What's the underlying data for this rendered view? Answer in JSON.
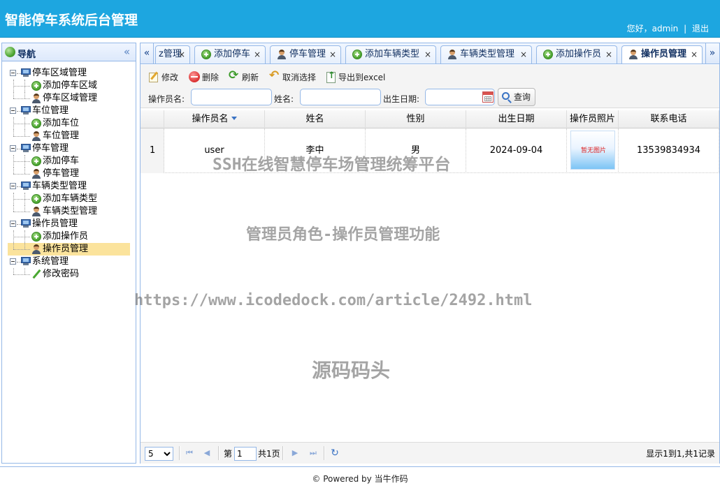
{
  "header": {
    "app_title": "智能停车系统后台管理",
    "greeting": "您好，admin",
    "separator": "|",
    "logout": "退出"
  },
  "nav": {
    "title": "导航",
    "collapse_icon": "double-chevron-left-icon",
    "groups": [
      {
        "label": "停车区域管理",
        "children": [
          {
            "label": "添加停车区域",
            "icon": "add-icon"
          },
          {
            "label": "停车区域管理",
            "icon": "user-icon"
          }
        ]
      },
      {
        "label": "车位管理",
        "children": [
          {
            "label": "添加车位",
            "icon": "add-icon"
          },
          {
            "label": "车位管理",
            "icon": "user-icon"
          }
        ]
      },
      {
        "label": "停车管理",
        "children": [
          {
            "label": "添加停车",
            "icon": "add-icon"
          },
          {
            "label": "停车管理",
            "icon": "user-icon"
          }
        ]
      },
      {
        "label": "车辆类型管理",
        "children": [
          {
            "label": "添加车辆类型",
            "icon": "add-icon"
          },
          {
            "label": "车辆类型管理",
            "icon": "user-icon"
          }
        ]
      },
      {
        "label": "操作员管理",
        "children": [
          {
            "label": "添加操作员",
            "icon": "add-icon"
          },
          {
            "label": "操作员管理",
            "icon": "user-icon",
            "selected": true
          }
        ]
      },
      {
        "label": "系统管理",
        "children": [
          {
            "label": "修改密码",
            "icon": "pencil-icon"
          }
        ]
      }
    ]
  },
  "tabs": {
    "scroll_left": "«",
    "scroll_right": "»",
    "items": [
      {
        "label": "z管理",
        "icon": "none"
      },
      {
        "label": "添加停车",
        "icon": "add-icon"
      },
      {
        "label": "停车管理",
        "icon": "user-icon"
      },
      {
        "label": "添加车辆类型",
        "icon": "add-icon"
      },
      {
        "label": "车辆类型管理",
        "icon": "user-icon"
      },
      {
        "label": "添加操作员",
        "icon": "add-icon"
      },
      {
        "label": "操作员管理",
        "icon": "user-icon",
        "active": true
      }
    ],
    "close_glyph": "×"
  },
  "toolbar": {
    "edit": "修改",
    "delete": "删除",
    "refresh": "刷新",
    "cancel_select": "取消选择",
    "export": "导出到excel"
  },
  "filters": {
    "operator_name_label": "操作员名:",
    "name_label": "姓名:",
    "birthdate_label": "出生日期:",
    "search_button": "查询"
  },
  "grid": {
    "columns": [
      "操作员名",
      "姓名",
      "性别",
      "出生日期",
      "操作员照片",
      "联系电话"
    ],
    "rows": [
      {
        "index": "1",
        "operator_name": "user",
        "name": "李中",
        "gender": "男",
        "birthdate": "2024-09-04",
        "photo_text": "暂无图片",
        "phone": "13539834934"
      }
    ]
  },
  "watermarks": {
    "line1": "SSH在线智慧停车场管理统筹平台",
    "line2": "管理员角色-操作员管理功能",
    "line3": "https://www.icodedock.com/article/2492.html",
    "line4": "源码码头"
  },
  "pager": {
    "page_size": "5",
    "page_prefix": "第",
    "page_value": "1",
    "page_total": "共1页",
    "info": "显示1到1,共1记录"
  },
  "footer": {
    "text": "© Powered by 当牛作码"
  }
}
